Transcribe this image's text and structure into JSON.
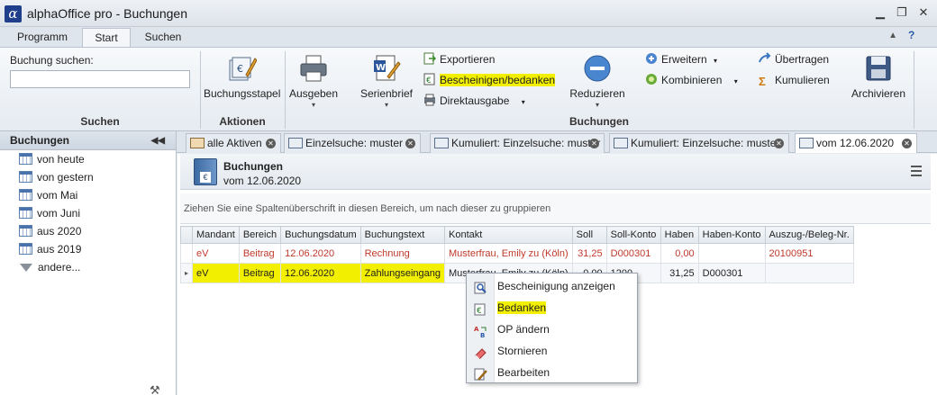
{
  "window": {
    "title": "alphaOffice pro - Buchungen",
    "logo_glyph": "α",
    "min_glyph": "▁",
    "restore_glyph": "❐",
    "close_glyph": "✕"
  },
  "ribbon_tabs": [
    "Programm",
    "Start",
    "Suchen"
  ],
  "ribbon_tabs_active": "Start",
  "ribbon_help_glyph": "?",
  "ribbon_collapse_glyph": "▲",
  "ribbon": {
    "search": {
      "label": "Buchung suchen:",
      "value": "",
      "group": "Suchen"
    },
    "aktionen": {
      "group": "Aktionen",
      "buchungsstapel": "Buchungsstapel"
    },
    "buchungen": {
      "group": "Buchungen",
      "ausgeben": "Ausgeben",
      "serienbrief": "Serienbrief",
      "exportieren": "Exportieren",
      "bescheinigen": "Bescheinigen/bedanken",
      "direktausgabe": "Direktausgabe",
      "reduzieren": "Reduzieren",
      "erweitern": "Erweitern",
      "kombinieren": "Kombinieren",
      "uebertragen": "Übertragen",
      "kumulieren": "Kumulieren",
      "archivieren": "Archivieren"
    },
    "dropdown_glyph": "▾"
  },
  "nav": {
    "title": "Buchungen",
    "collapse_glyph": "◀◀",
    "items": [
      "von heute",
      "von gestern",
      "vom Mai",
      "vom Juni",
      "aus 2020",
      "aus 2019",
      "andere..."
    ],
    "tools_glyph": "⚒"
  },
  "doc_tabs": [
    "alle Aktiven",
    "Einzelsuche: muster",
    "Kumuliert: Einzelsuche: muster",
    "Kumuliert: Einzelsuche: muster",
    "vom 12.06.2020"
  ],
  "doc_tab_close_glyph": "✕",
  "content": {
    "title": "Buchungen",
    "subtitle": "vom 12.06.2020",
    "group_hint": "Ziehen Sie eine Spaltenüberschrift in diesen Bereich, um nach dieser zu gruppieren"
  },
  "grid": {
    "columns": [
      "Mandant",
      "Bereich",
      "Buchungsdatum",
      "Buchungstext",
      "Kontakt",
      "Soll",
      "Soll-Konto",
      "Haben",
      "Haben-Konto",
      "Auszug-/Beleg-Nr."
    ],
    "row_indicator_glyph": "▸",
    "rows": [
      {
        "Mandant": "eV",
        "Bereich": "Beitrag",
        "Buchungsdatum": "12.06.2020",
        "Buchungstext": "Rechnung",
        "Kontakt": "Musterfrau, Emily zu (Köln)",
        "Soll": "31,25",
        "SollKonto": "D000301",
        "Haben": "0,00",
        "HabenKonto": "",
        "Beleg": "20100951"
      },
      {
        "Mandant": "eV",
        "Bereich": "Beitrag",
        "Buchungsdatum": "12.06.2020",
        "Buchungstext": "Zahlungseingang",
        "Kontakt": "Musterfrau, Emily zu (Köln)",
        "Soll": "0,00",
        "SollKonto": "1200",
        "Haben": "31,25",
        "HabenKonto": "D000301",
        "Beleg": ""
      }
    ]
  },
  "context_menu": {
    "items": [
      "Bescheinigung anzeigen",
      "Bedanken",
      "OP ändern",
      "Stornieren",
      "Bearbeiten"
    ]
  },
  "colors": {
    "highlight": "#f2f000",
    "red_row_text": "#c0392b",
    "logo": "#1f3f8a"
  }
}
